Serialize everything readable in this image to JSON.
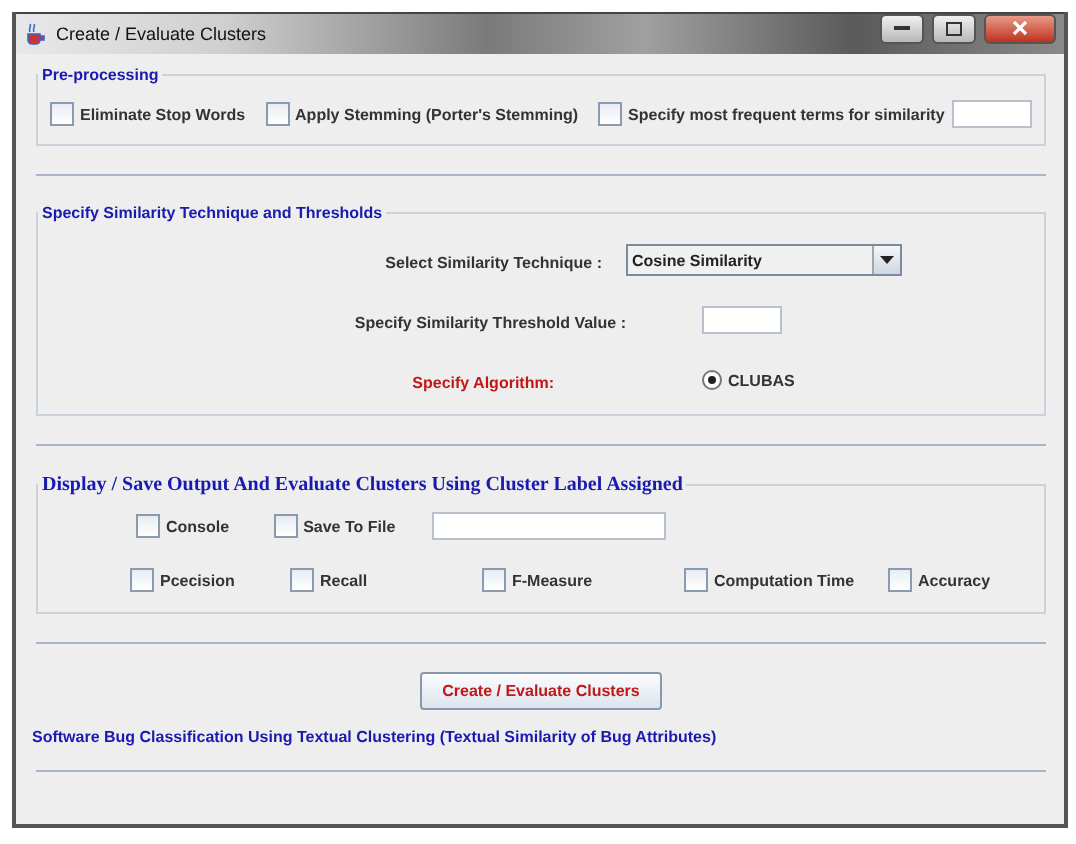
{
  "window": {
    "title": "Create / Evaluate Clusters"
  },
  "preprocessing": {
    "title": "Pre-processing",
    "options": [
      {
        "label": "Eliminate Stop Words",
        "checked": false
      },
      {
        "label": "Apply Stemming (Porter's Stemming)",
        "checked": false
      },
      {
        "label": "Specify most frequent terms for similarity",
        "checked": false
      }
    ]
  },
  "similarity": {
    "title": "Specify Similarity Technique and Thresholds",
    "technique_label": "Select Similarity Technique :",
    "technique_value": "Cosine Similarity",
    "threshold_label": "Specify Similarity Threshold Value :",
    "algorithm_label": "Specify Algorithm:",
    "algorithms": [
      {
        "label": "CLUBAS",
        "selected": true
      }
    ]
  },
  "output": {
    "title": "Display / Save Output And Evaluate Clusters Using Cluster Label Assigned",
    "outputs": [
      {
        "label": "Console",
        "checked": false
      },
      {
        "label": "Save To File",
        "checked": false
      }
    ],
    "measures": [
      {
        "label": "Pcecision",
        "checked": false
      },
      {
        "label": "Recall",
        "checked": false
      },
      {
        "label": "F-Measure",
        "checked": false
      },
      {
        "label": "Computation Time",
        "checked": false
      },
      {
        "label": "Accuracy",
        "checked": false
      }
    ]
  },
  "action_button": "Create / Evaluate Clusters",
  "footer": "Software Bug Classification Using Textual Clustering (Textual Similarity of Bug Attributes)"
}
